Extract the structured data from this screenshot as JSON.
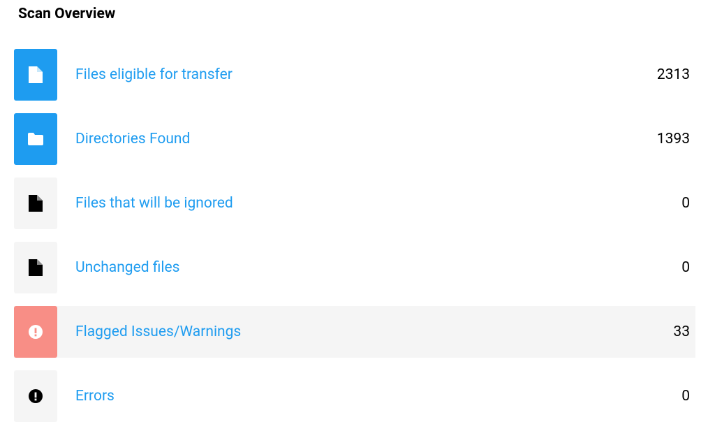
{
  "title": "Scan Overview",
  "rows": [
    {
      "label": "Files eligible for transfer",
      "value": "2313"
    },
    {
      "label": "Directories Found",
      "value": "1393"
    },
    {
      "label": "Files that will be ignored",
      "value": "0"
    },
    {
      "label": "Unchanged files",
      "value": "0"
    },
    {
      "label": "Flagged Issues/Warnings",
      "value": "33"
    },
    {
      "label": "Errors",
      "value": "0"
    }
  ]
}
